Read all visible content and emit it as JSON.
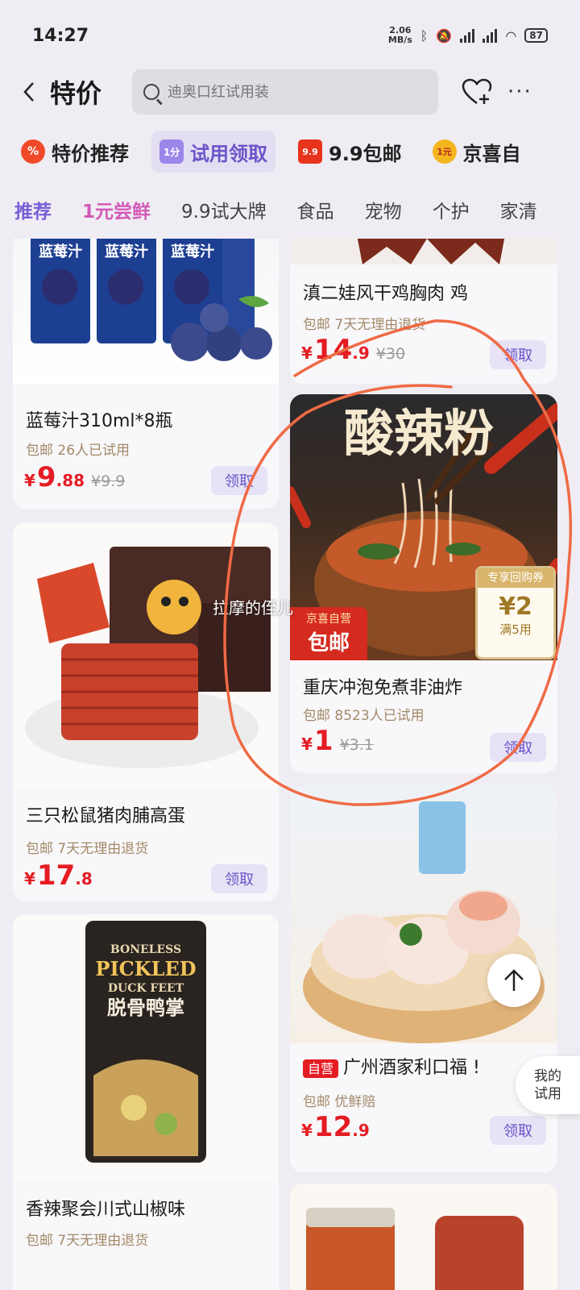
{
  "status_bar": {
    "time": "14:27",
    "net_speed_value": "2.06",
    "net_speed_unit": "MB/s",
    "battery": "87"
  },
  "header": {
    "title": "特价",
    "search_placeholder": "迪奥口红试用装"
  },
  "channels": [
    {
      "label": "特价推荐",
      "icon": "percent-fire-icon",
      "badge": "%",
      "active": false
    },
    {
      "label": "试用领取",
      "icon": "trial-bag-icon",
      "badge": "1分",
      "active": true
    },
    {
      "label": "9.9包邮",
      "icon": "price-tag-icon",
      "badge": "9.9",
      "active": false
    },
    {
      "label": "京喜自",
      "icon": "coin-icon",
      "badge": "1元",
      "active": false
    }
  ],
  "tabs": [
    {
      "label": "推荐",
      "state": "active"
    },
    {
      "label": "1元尝鲜",
      "state": "promo"
    },
    {
      "label": "9.9试大牌",
      "state": ""
    },
    {
      "label": "食品",
      "state": ""
    },
    {
      "label": "宠物",
      "state": ""
    },
    {
      "label": "个护",
      "state": ""
    },
    {
      "label": "家清",
      "state": ""
    }
  ],
  "products": {
    "blueberry": {
      "image_text": "蓝莓汁",
      "name": "蓝莓汁310ml*8瓶",
      "meta": "包邮  26人已试用",
      "price_int": "9",
      "price_dec": ".88",
      "orig": "¥9.9",
      "claim": "领取"
    },
    "chicken": {
      "name": "滇二娃风干鸡胸肉 鸡",
      "meta": "包邮  7天无理由退货",
      "price_int": "14",
      "price_dec": ".9",
      "orig": "¥30",
      "claim": "领取"
    },
    "noodle": {
      "image_title": "酸辣粉",
      "tag_top": "京喜自营",
      "tag_main": "包邮",
      "name": "重庆冲泡免煮非油炸",
      "meta": "包邮  8523人已试用",
      "price_int": "1",
      "price_dec": "",
      "orig": "¥3.1",
      "claim": "领取"
    },
    "jerky": {
      "name": "三只松鼠猪肉脯高蛋",
      "meta": "包邮  7天无理由退货",
      "price_int": "17",
      "price_dec": ".8",
      "orig": "",
      "claim": "领取"
    },
    "dimsum": {
      "self_badge": "自营",
      "name": "广州酒家利口福 !",
      "meta": "包邮  优鲜赔",
      "price_int": "12",
      "price_dec": ".9",
      "orig": "",
      "claim": "领取"
    },
    "duck": {
      "image_line1": "BONELESS",
      "image_line2": "PICKLED",
      "image_line3": "DUCK FEET",
      "image_line4": "脱骨鸭掌",
      "name": "香辣聚会川式山椒味",
      "meta": "包邮  7天无理由退货"
    }
  },
  "coupon": {
    "header": "专享回购券",
    "amount": "¥2",
    "condition": "满5用"
  },
  "floating": {
    "my_trial_line1": "我的",
    "my_trial_line2": "试用"
  },
  "watermark": "拉摩的侄儿",
  "colors": {
    "accent": "#6a54c9",
    "price": "#e51c23",
    "meta": "#a38a69",
    "annotation": "#ef6a45"
  }
}
